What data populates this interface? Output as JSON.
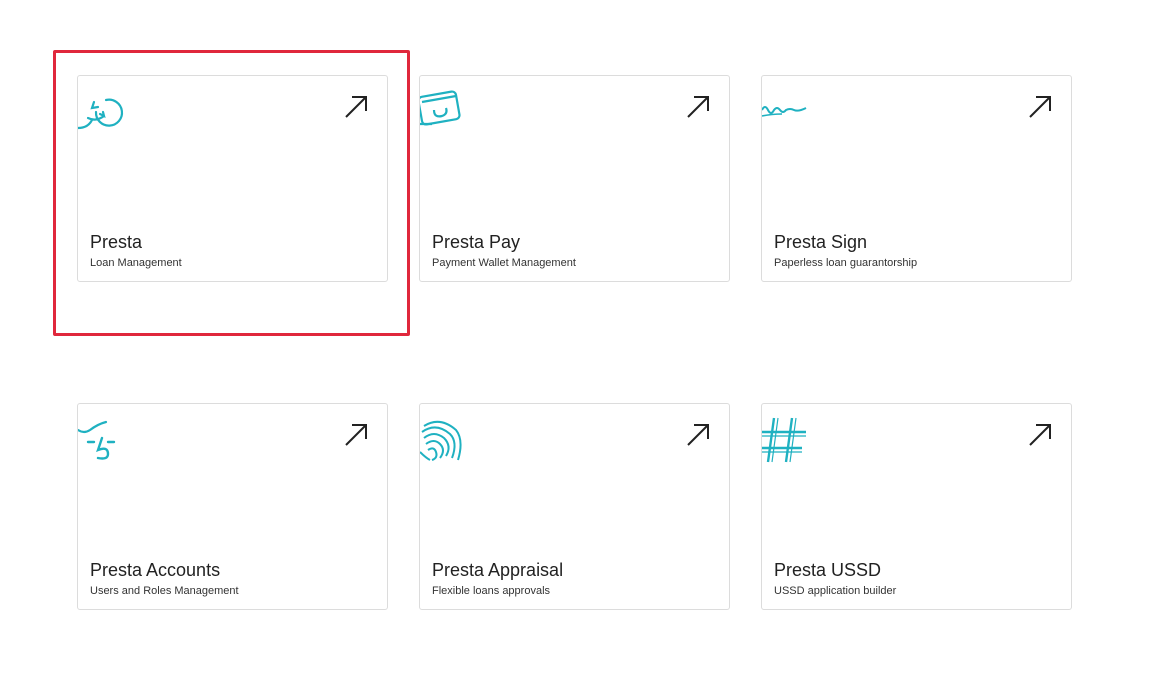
{
  "colors": {
    "accent": "#1fb1c1",
    "highlight": "#e0283c",
    "card_border": "#dcdcdc"
  },
  "cards": [
    {
      "title": "Presta",
      "subtitle": "Loan Management",
      "icon": "refresh-coin-icon",
      "selected": true
    },
    {
      "title": "Presta Pay",
      "subtitle": "Payment Wallet Management",
      "icon": "wallet-card-icon"
    },
    {
      "title": "Presta Sign",
      "subtitle": "Paperless loan guarantorship",
      "icon": "signature-icon"
    },
    {
      "title": "Presta Accounts",
      "subtitle": "Users and Roles Management",
      "icon": "accounts-icon"
    },
    {
      "title": "Presta Appraisal",
      "subtitle": "Flexible loans approvals",
      "icon": "fingerprint-icon"
    },
    {
      "title": "Presta USSD",
      "subtitle": "USSD application builder",
      "icon": "hash-icon"
    }
  ]
}
